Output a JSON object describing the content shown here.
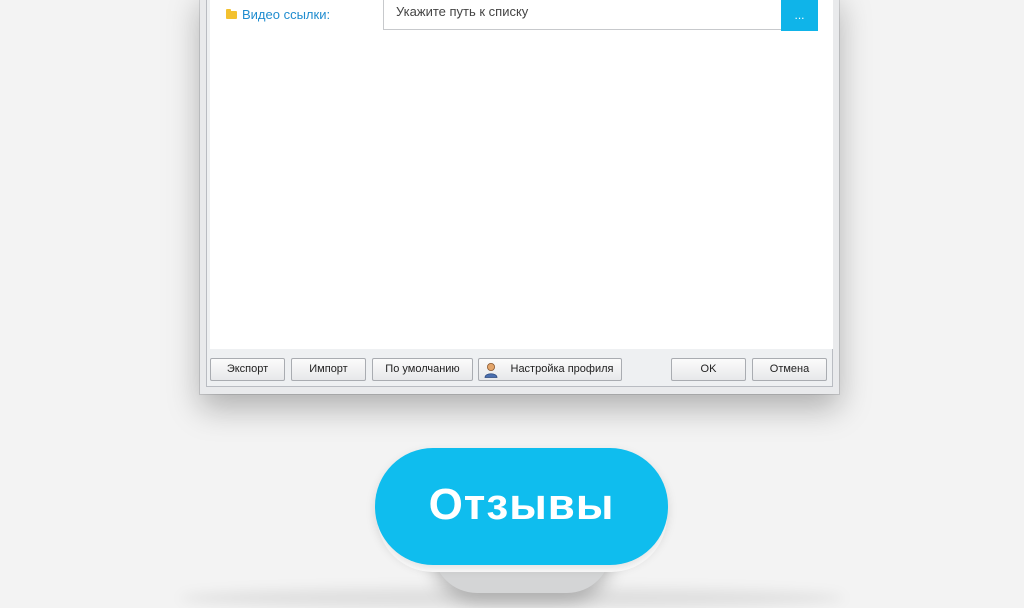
{
  "dialog": {
    "field": {
      "label": "Видео ссылки:",
      "placeholder": "Укажите путь к списку",
      "browse_label": "..."
    },
    "buttons": {
      "export": "Экспорт",
      "import": "Импорт",
      "default": "По умолчанию",
      "profile_settings": "Настройка профиля",
      "ok": "OK",
      "cancel": "Отмена"
    }
  },
  "cta": {
    "label": "Отзывы",
    "color": "#0fbdee"
  },
  "colors": {
    "accent": "#0fb4e9",
    "label": "#1f8ccf"
  },
  "icons": {
    "field": "folder-icon",
    "profile": "user-icon"
  }
}
